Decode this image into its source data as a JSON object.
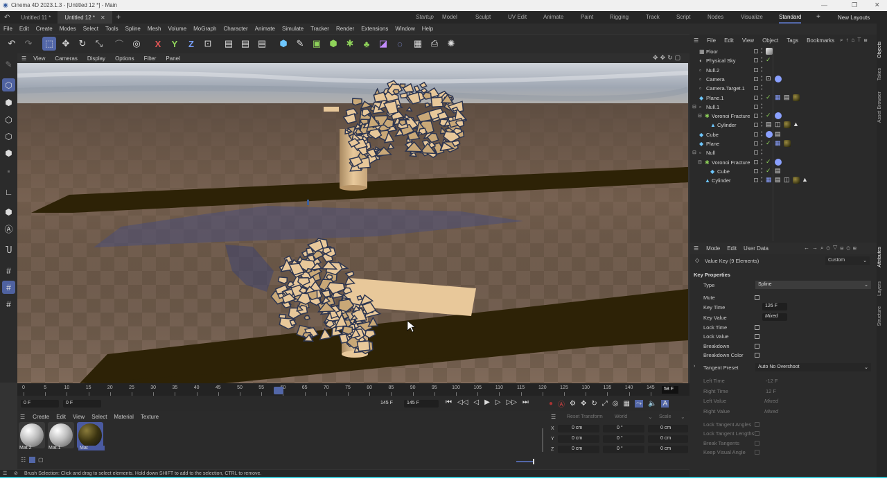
{
  "window": {
    "title": "Cinema 4D 2023.1.3 - [Untitled 12 *] - Main"
  },
  "doc_tabs": [
    {
      "label": "Untitled 11 *"
    },
    {
      "label": "Untitled 12 *"
    }
  ],
  "layout_tabs": [
    "Startup",
    "Model",
    "Sculpt",
    "UV Edit",
    "Animate",
    "Paint",
    "Rigging",
    "Track",
    "Script",
    "Nodes",
    "Visualize",
    "Standard"
  ],
  "new_layouts": "New Layouts",
  "menu": [
    "File",
    "Edit",
    "Create",
    "Modes",
    "Select",
    "Tools",
    "Spline",
    "Mesh",
    "Volume",
    "MoGraph",
    "Character",
    "Animate",
    "Simulate",
    "Tracker",
    "Render",
    "Extensions",
    "Window",
    "Help"
  ],
  "viewport_menu": [
    "View",
    "Cameras",
    "Display",
    "Options",
    "Filter",
    "Panel"
  ],
  "timeline": {
    "ticks": [
      "0",
      "5",
      "10",
      "15",
      "20",
      "25",
      "30",
      "35",
      "40",
      "45",
      "50",
      "55",
      "60",
      "65",
      "70",
      "75",
      "80",
      "85",
      "90",
      "95",
      "100",
      "105",
      "110",
      "115",
      "120",
      "125",
      "130",
      "135",
      "140",
      "145"
    ],
    "current_frame_badge": "58 F",
    "start_field": "0 F",
    "start_field2": "0 F",
    "end_field": "145 F",
    "end_field2": "145 F",
    "playhead_frame": 58
  },
  "material_panel": {
    "menu": [
      "Create",
      "Edit",
      "View",
      "Select",
      "Material",
      "Texture"
    ],
    "materials": [
      {
        "name": "Mat.2"
      },
      {
        "name": "Mat.1"
      },
      {
        "name": "Mat"
      }
    ]
  },
  "coords": {
    "header": [
      "Reset Transform",
      "World",
      "Scale"
    ],
    "rows": [
      {
        "axis": "X",
        "pos": "0 cm",
        "rot": "0 °",
        "size": "0 cm"
      },
      {
        "axis": "Y",
        "pos": "0 cm",
        "rot": "0 °",
        "size": "0 cm"
      },
      {
        "axis": "Z",
        "pos": "0 cm",
        "rot": "0 °",
        "size": "0 cm"
      }
    ]
  },
  "status": "Brush Selection: Click and drag to select elements. Hold down SHIFT to add to the selection, CTRL to remove.",
  "object_manager": {
    "menu": [
      "File",
      "Edit",
      "View",
      "Object",
      "Tags",
      "Bookmarks"
    ],
    "objects": [
      {
        "name": "Floor"
      },
      {
        "name": "Physical Sky"
      },
      {
        "name": "Null.2"
      },
      {
        "name": "Camera"
      },
      {
        "name": "Camera.Target.1"
      },
      {
        "name": "Plane.1"
      },
      {
        "name": "Null.1"
      },
      {
        "name": "Voronoi Fracture"
      },
      {
        "name": "Cylinder"
      },
      {
        "name": "Cube"
      },
      {
        "name": "Plane"
      },
      {
        "name": "Null"
      },
      {
        "name": "Voronoi Fracture"
      },
      {
        "name": "Cube"
      },
      {
        "name": "Cylinder"
      }
    ]
  },
  "attributes": {
    "menu": [
      "Mode",
      "Edit",
      "User Data"
    ],
    "header": "Value Key (9 Elements)",
    "header_select": "Custom",
    "section": "Key Properties",
    "type_label": "Type",
    "type_value": "Spline",
    "mute": "Mute",
    "key_time_label": "Key Time",
    "key_time_value": "126 F",
    "key_value_label": "Key Value",
    "key_value_value": "Mixed",
    "lock_time": "Lock Time",
    "lock_value": "Lock Value",
    "breakdown": "Breakdown",
    "breakdown_color": "Breakdown Color",
    "tangent_preset_label": "Tangent Preset",
    "tangent_preset_value": "Auto No Overshoot",
    "left_time_label": "Left Time",
    "left_time_value": "-12 F",
    "right_time_label": "Right Time",
    "right_time_value": "12 F",
    "left_value_label": "Left Value",
    "left_value_value": "Mixed",
    "right_value_label": "Right Value",
    "right_value_value": "Mixed",
    "lock_tangent_angles": "Lock Tangent Angles",
    "lock_tangent_lengths": "Lock Tangent Lengths",
    "break_tangents": "Break Tangents",
    "keep_visual_angle": "Keep Visual Angle"
  },
  "side_tabs": [
    "Objects",
    "Takes",
    "Asset Browser",
    "Attributes",
    "Layers",
    "Structure"
  ],
  "colors": {
    "accent": "#5367a8",
    "floor": "#7a6454",
    "plank": "#2d2206",
    "shard": "#e8c89a"
  }
}
